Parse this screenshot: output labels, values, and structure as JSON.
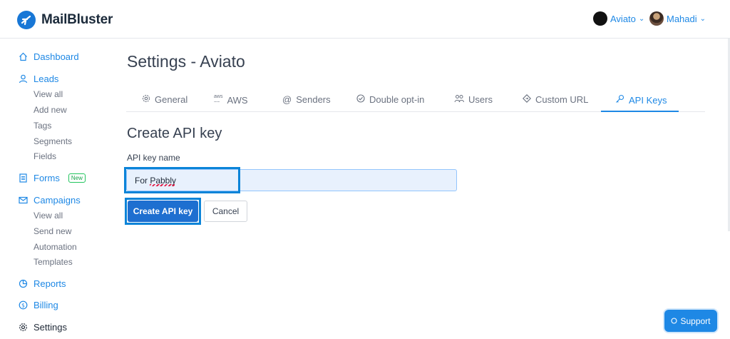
{
  "app": {
    "name": "MailBluster"
  },
  "header": {
    "account_aviato": "Aviato",
    "account_mahadi": "Mahadi"
  },
  "sidebar": {
    "dashboard": "Dashboard",
    "leads": "Leads",
    "leads_items": [
      "View all",
      "Add new",
      "Tags",
      "Segments",
      "Fields"
    ],
    "forms": "Forms",
    "forms_badge": "New",
    "campaigns": "Campaigns",
    "campaigns_items": [
      "View all",
      "Send new",
      "Automation",
      "Templates"
    ],
    "reports": "Reports",
    "billing": "Billing",
    "settings": "Settings"
  },
  "page": {
    "title": "Settings - Aviato"
  },
  "tabs": [
    {
      "label": "General",
      "icon": "gear-icon"
    },
    {
      "label": "AWS",
      "icon": "aws-icon"
    },
    {
      "label": "Senders",
      "icon": "at-icon"
    },
    {
      "label": "Double opt-in",
      "icon": "check-circle-icon"
    },
    {
      "label": "Users",
      "icon": "users-icon"
    },
    {
      "label": "Custom URL",
      "icon": "diamond-link-icon"
    },
    {
      "label": "API Keys",
      "icon": "key-icon",
      "active": true
    }
  ],
  "form": {
    "section_title": "Create API key",
    "field_label": "API key name",
    "field_value": "For Pabbly",
    "submit_label": "Create API key",
    "cancel_label": "Cancel"
  },
  "support": {
    "label": "Support"
  },
  "colors": {
    "accent": "#1e88e5",
    "primary_button": "#1e6fd0",
    "highlight": "#0b84d8"
  }
}
